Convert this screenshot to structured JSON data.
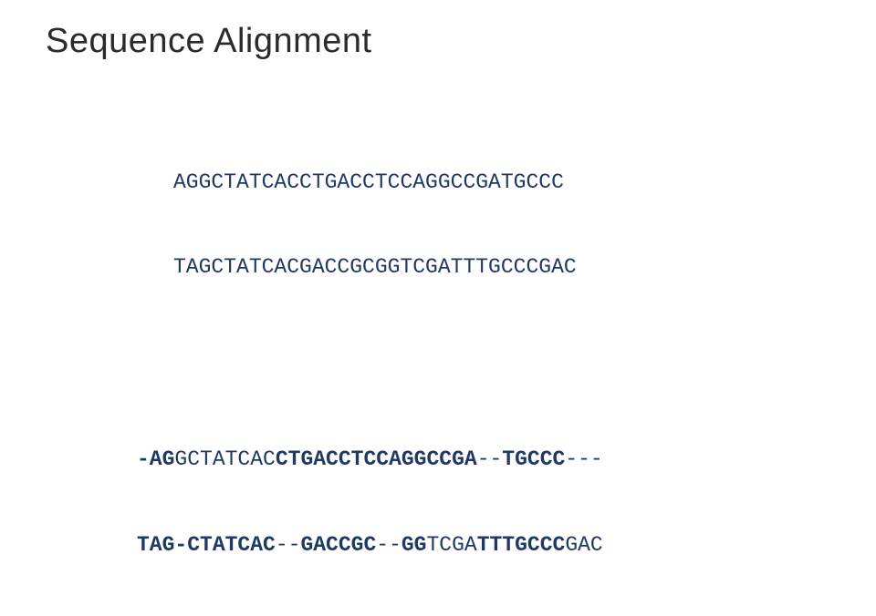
{
  "title": "Sequence Alignment",
  "block1": {
    "line1": "AGGCTATCACCTGACCTCCAGGCCGATGCCC",
    "line2": "TAGCTATCACGACCGCGGTCGATTTGCCCGAC"
  },
  "block2": {
    "line1": {
      "a": "-AG",
      "b": "GCTATCAC",
      "c": "CTGACCTCCAGGCCGA",
      "d": "--",
      "e": "TGCCC",
      "f": "---"
    },
    "line2": {
      "a": "TAG-CTATCAC",
      "b": "--",
      "c": "GACCGC",
      "d": "--",
      "e": "GG",
      "f": "TCGA",
      "g": "TTTGCCC",
      "h": "GAC"
    }
  }
}
